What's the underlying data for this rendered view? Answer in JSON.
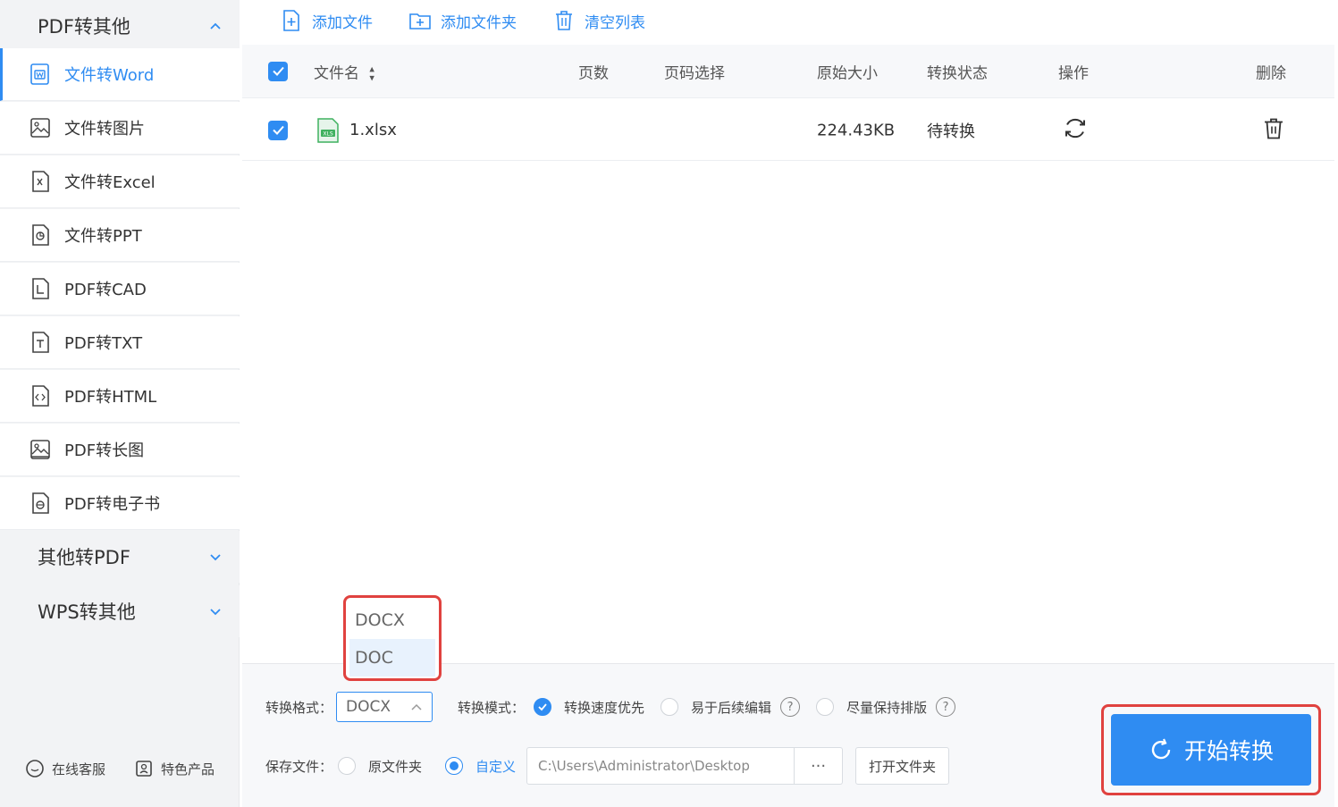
{
  "sidebar": {
    "groups": [
      {
        "label": "PDF转其他",
        "chevron": "chevron-up-icon"
      },
      {
        "label": "其他转PDF",
        "chevron": "chevron-down-icon"
      },
      {
        "label": "WPS转其他",
        "chevron": "chevron-down-icon"
      }
    ],
    "items": [
      {
        "label": "文件转Word",
        "icon": "word-doc-icon",
        "active": true
      },
      {
        "label": "文件转图片",
        "icon": "image-icon"
      },
      {
        "label": "文件转Excel",
        "icon": "excel-doc-icon"
      },
      {
        "label": "文件转PPT",
        "icon": "ppt-doc-icon"
      },
      {
        "label": "PDF转CAD",
        "icon": "cad-doc-icon"
      },
      {
        "label": "PDF转TXT",
        "icon": "txt-doc-icon"
      },
      {
        "label": "PDF转HTML",
        "icon": "html-doc-icon"
      },
      {
        "label": "PDF转长图",
        "icon": "long-image-icon"
      },
      {
        "label": "PDF转电子书",
        "icon": "ebook-doc-icon"
      }
    ],
    "footer": {
      "support": "在线客服",
      "products": "特色产品"
    }
  },
  "toolbar": {
    "add_file": "添加文件",
    "add_folder": "添加文件夹",
    "clear_list": "清空列表"
  },
  "table": {
    "headers": {
      "filename": "文件名",
      "pages": "页数",
      "page_select": "页码选择",
      "size": "原始大小",
      "status": "转换状态",
      "action": "操作",
      "delete": "删除"
    },
    "rows": [
      {
        "filename": "1.xlsx",
        "pages": "",
        "page_select": "",
        "size": "224.43KB",
        "status": "待转换",
        "checked": true
      }
    ]
  },
  "options": {
    "format_label": "转换格式：",
    "format_value": "DOCX",
    "format_options": [
      "DOCX",
      "DOC"
    ],
    "mode_label": "转换模式：",
    "modes": [
      "转换速度优先",
      "易于后续编辑",
      "尽量保持排版"
    ],
    "mode_selected": "转换速度优先",
    "save_label": "保存文件：",
    "save_options": [
      "原文件夹",
      "自定义"
    ],
    "save_selected": "自定义",
    "save_path": "C:\\Users\\Administrator\\Desktop",
    "browse_label": "···",
    "open_folder": "打开文件夹"
  },
  "start_button": "开始转换",
  "colors": {
    "accent": "#2f8cf2",
    "highlight_border": "#e0423f"
  }
}
